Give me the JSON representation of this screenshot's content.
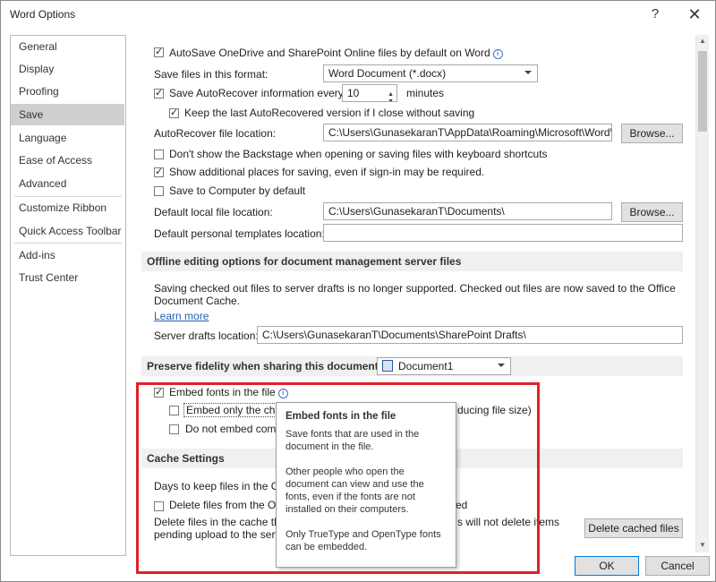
{
  "window": {
    "title": "Word Options",
    "help": "?",
    "close": "✕"
  },
  "nav": {
    "items": [
      "General",
      "Display",
      "Proofing",
      "Save",
      "Language",
      "Ease of Access",
      "Advanced",
      "Customize Ribbon",
      "Quick Access Toolbar",
      "Add-ins",
      "Trust Center"
    ],
    "selected": "Save"
  },
  "save": {
    "autosave_label": "AutoSave OneDrive and SharePoint Online files by default on Word",
    "format_label": "Save files in this format:",
    "format_value": "Word Document (*.docx)",
    "autorecover_label": "Save AutoRecover information every",
    "autorecover_minutes": "10",
    "minutes_label": "minutes",
    "keep_last_label": "Keep the last AutoRecovered version if I close without saving",
    "autorecover_location_label": "AutoRecover file location:",
    "autorecover_location_value": "C:\\Users\\GunasekaranT\\AppData\\Roaming\\Microsoft\\Word\\",
    "browse1": "Browse...",
    "dont_show_backstage_label": "Don't show the Backstage when opening or saving files with keyboard shortcuts",
    "show_additional_label": "Show additional places for saving, even if sign-in may be required.",
    "save_to_computer_label": "Save to Computer by default",
    "default_local_label": "Default local file location:",
    "default_local_value": "C:\\Users\\GunasekaranT\\Documents\\",
    "browse2": "Browse...",
    "default_templates_label": "Default personal templates location:",
    "default_templates_value": ""
  },
  "offline": {
    "header": "Offline editing options for document management server files",
    "text_line1": "Saving checked out files to server drafts is no longer supported. Checked out files are now saved to the Office",
    "text_line2": "Document Cache.",
    "learn_more": "Learn more",
    "server_drafts_label": "Server drafts location:",
    "server_drafts_value": "C:\\Users\\GunasekaranT\\Documents\\SharePoint Drafts\\"
  },
  "fidelity": {
    "header": "Preserve fidelity when sharing this document:",
    "document": "Document1",
    "embed_fonts_label": "Embed fonts in the file",
    "embed_only_label": "Embed only the cha",
    "embed_only_tail": "ducing file size)",
    "do_not_embed_label": "Do not embed comm"
  },
  "cache": {
    "header": "Cache Settings",
    "days_label": "Days to keep files in the Off",
    "delete_files_label": "Delete files from the Off",
    "delete_files_tail": "ed",
    "delete_text_line1": "Delete files in the cache tha",
    "delete_text_tail": "s will not delete items",
    "delete_text_line2": "pending upload to the serv",
    "delete_cached_button": "Delete cached files"
  },
  "tooltip": {
    "title": "Embed fonts in the file",
    "p1": "Save fonts that are used in the document in the file.",
    "p2": "Other people who open the document can view and use the fonts, even if the fonts are not installed on their computers.",
    "p3": "Only TrueType and OpenType fonts can be embedded."
  },
  "footer": {
    "ok": "OK",
    "cancel": "Cancel"
  },
  "colors": {
    "highlight": "#e0202a",
    "link": "#1f5fb3",
    "selected_nav": "#cfcfcf"
  }
}
